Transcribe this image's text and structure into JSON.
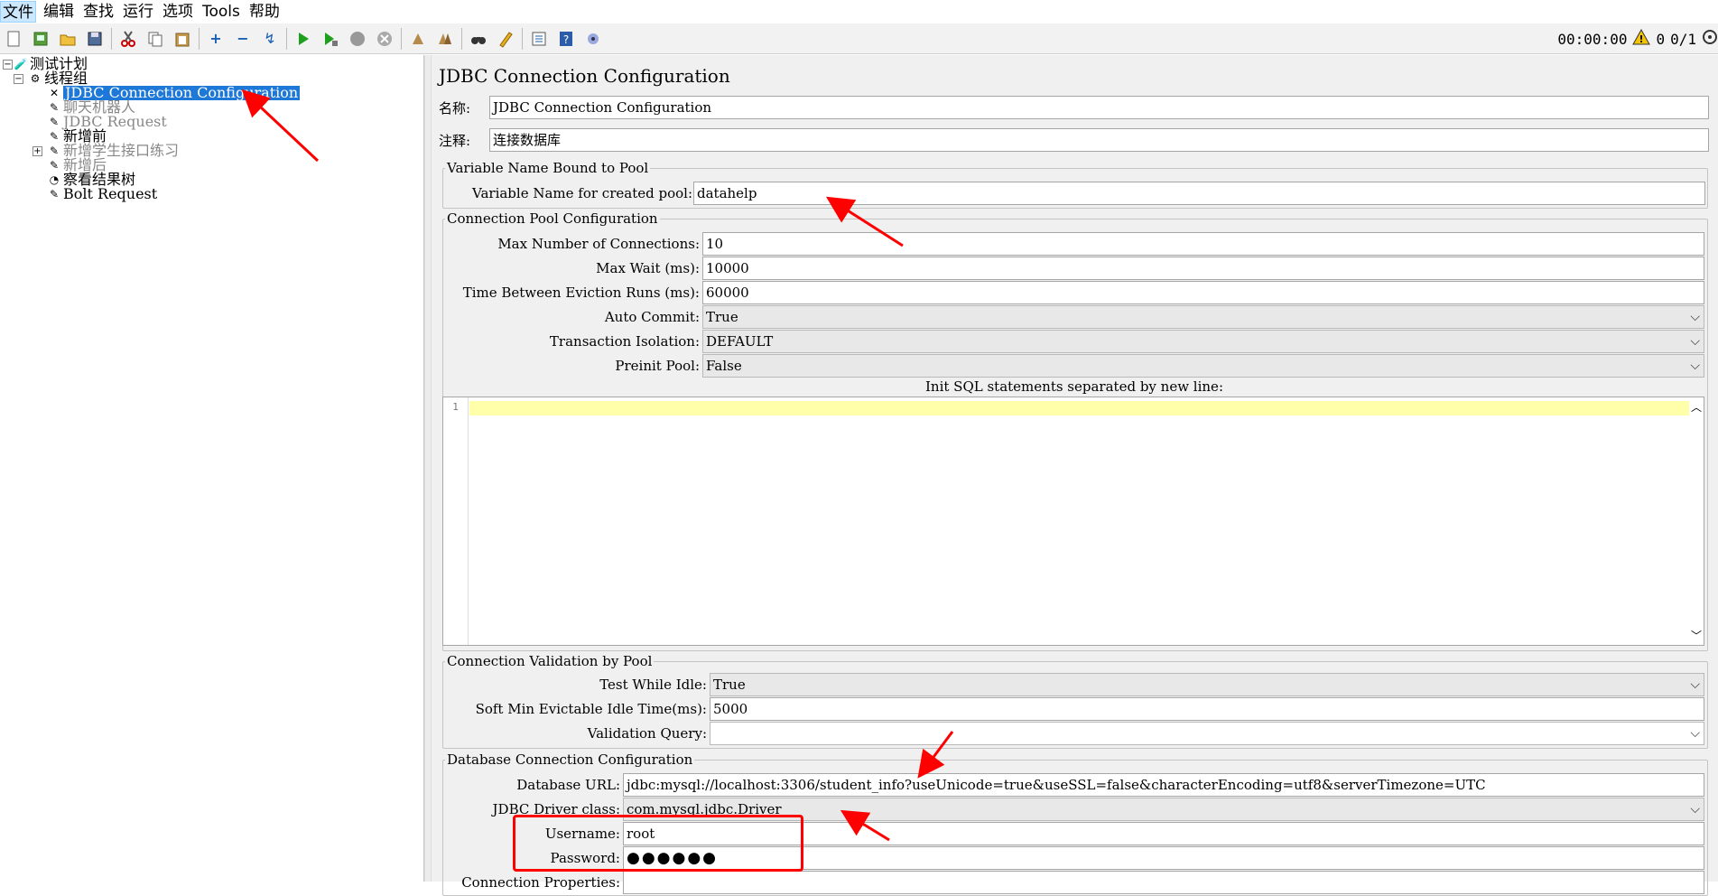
{
  "menubar": {
    "items": [
      "文件",
      "编辑",
      "查找",
      "运行",
      "选项",
      "Tools",
      "帮助"
    ]
  },
  "status": {
    "timer": "00:00:00",
    "warnings": "0",
    "threads": "0/1"
  },
  "tree": {
    "nodes": [
      {
        "label": "测试计划",
        "icon": "test-plan-icon"
      },
      {
        "label": "线程组",
        "icon": "gear-icon"
      },
      {
        "label": "JDBC Connection Configuration",
        "icon": "wrench-icon"
      },
      {
        "label": "聊天机器人",
        "icon": "pipette-icon"
      },
      {
        "label": "JDBC Request",
        "icon": "pipette-icon"
      },
      {
        "label": "新增前",
        "icon": "pipette-icon"
      },
      {
        "label": "新增学生接口练习",
        "icon": "pipette-icon"
      },
      {
        "label": "新增后",
        "icon": "pipette-icon"
      },
      {
        "label": "察看结果树",
        "icon": "listener-icon"
      },
      {
        "label": "Bolt Request",
        "icon": "pipette-icon"
      }
    ]
  },
  "panel": {
    "title": "JDBC Connection Configuration",
    "name_label": "名称:",
    "name_value": "JDBC Connection Configuration",
    "comment_label": "注释:",
    "comment_value": "连接数据库",
    "var_section": {
      "legend": "Variable Name Bound to Pool",
      "label": "Variable Name for created pool:",
      "value": "datahelp"
    },
    "pool_section": {
      "legend": "Connection Pool Configuration",
      "max_conn_label": "Max Number of Connections:",
      "max_conn_value": "10",
      "max_wait_label": "Max Wait (ms):",
      "max_wait_value": "10000",
      "eviction_label": "Time Between Eviction Runs (ms):",
      "eviction_value": "60000",
      "auto_commit_label": "Auto Commit:",
      "auto_commit_value": "True",
      "isolation_label": "Transaction Isolation:",
      "isolation_value": "DEFAULT",
      "preinit_label": "Preinit Pool:",
      "preinit_value": "False",
      "init_sql_label": "Init SQL statements separated by new line:",
      "line_number": "1"
    },
    "validation_section": {
      "legend": "Connection Validation by Pool",
      "test_idle_label": "Test While Idle:",
      "test_idle_value": "True",
      "soft_min_label": "Soft Min Evictable Idle Time(ms):",
      "soft_min_value": "5000",
      "query_label": "Validation Query:",
      "query_value": ""
    },
    "db_section": {
      "legend": "Database Connection Configuration",
      "url_label": "Database URL:",
      "url_value": "jdbc:mysql://localhost:3306/student_info?useUnicode=true&useSSL=false&characterEncoding=utf8&serverTimezone=UTC",
      "driver_label": "JDBC Driver class:",
      "driver_value": "com.mysql.jdbc.Driver",
      "username_label": "Username:",
      "username_value": "root",
      "password_label": "Password:",
      "password_value": "●●●●●●",
      "props_label": "Connection Properties:"
    }
  },
  "colors": {
    "selection": "#1e78d7",
    "annotation": "#ff0000",
    "highlight_line": "#ffffaa"
  }
}
